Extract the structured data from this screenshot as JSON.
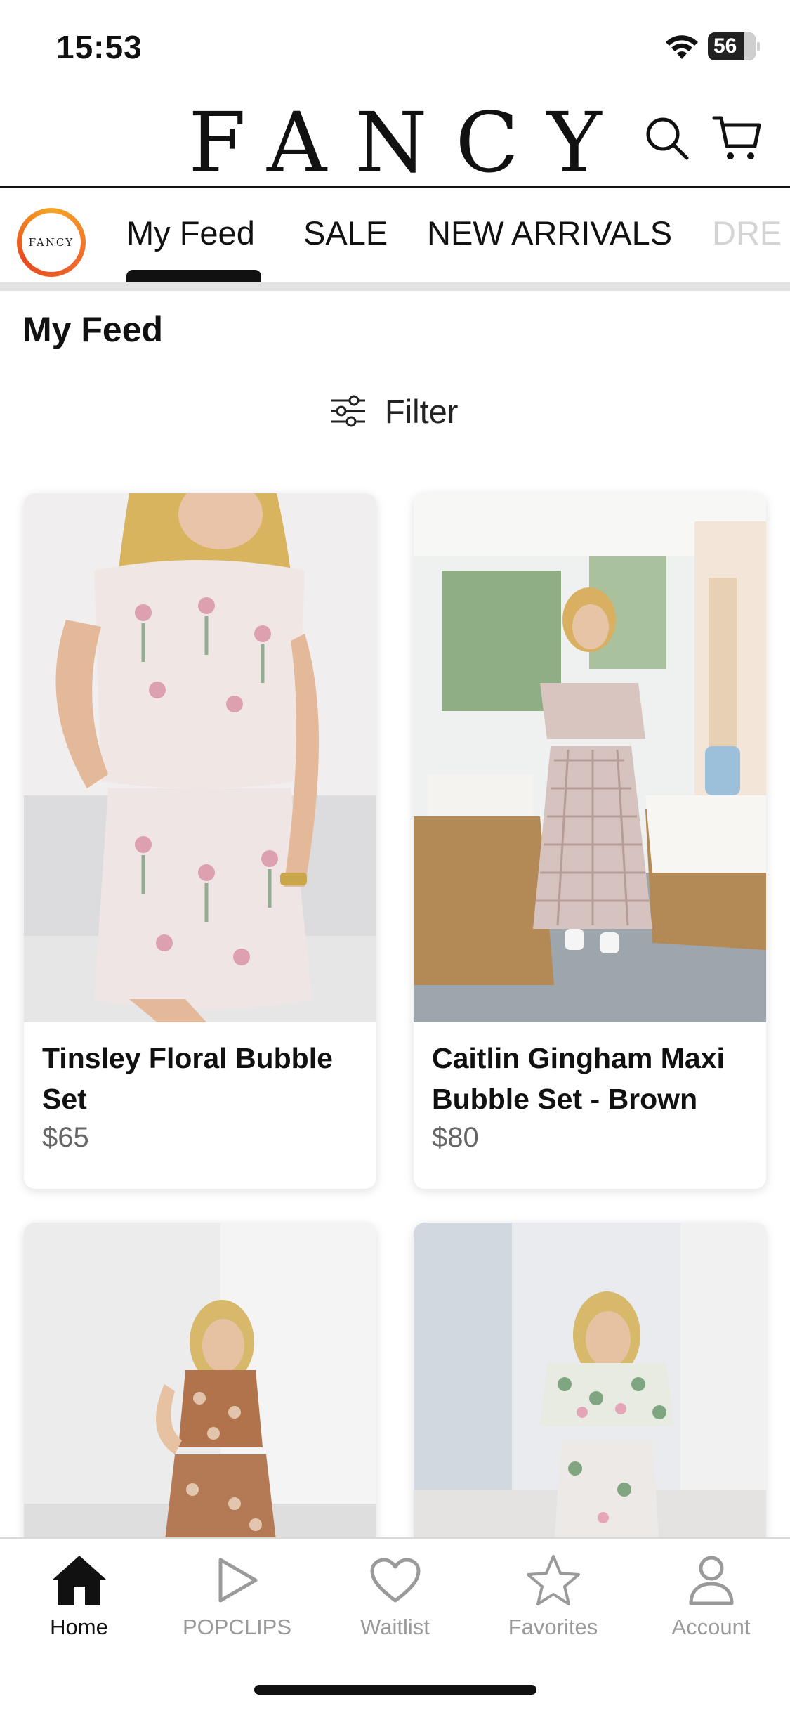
{
  "status_bar": {
    "time": "15:53",
    "battery": "56"
  },
  "header": {
    "logo": "FANCY"
  },
  "brand_badge": {
    "text": "FANCY"
  },
  "tabs": [
    {
      "label": "My Feed"
    },
    {
      "label": "SALE"
    },
    {
      "label": "NEW ARRIVALS"
    },
    {
      "label": "DRE"
    }
  ],
  "feed": {
    "title": "My Feed",
    "filter_label": "Filter"
  },
  "products": [
    {
      "name": "Tinsley Floral Bubble Set",
      "price": "$65"
    },
    {
      "name": "Caitlin Gingham Maxi Bubble Set - Brown",
      "price": "$80"
    },
    {
      "name": "",
      "price": ""
    },
    {
      "name": "",
      "price": ""
    }
  ],
  "bottom_nav": [
    {
      "label": "Home",
      "icon": "home-icon"
    },
    {
      "label": "POPCLIPS",
      "icon": "play-icon"
    },
    {
      "label": "Waitlist",
      "icon": "heart-icon"
    },
    {
      "label": "Favorites",
      "icon": "star-icon"
    },
    {
      "label": "Account",
      "icon": "user-icon"
    }
  ],
  "colors": {
    "accent": "#111111",
    "badge_ring": "#f06b2c",
    "inactive": "#9a9a9a"
  }
}
